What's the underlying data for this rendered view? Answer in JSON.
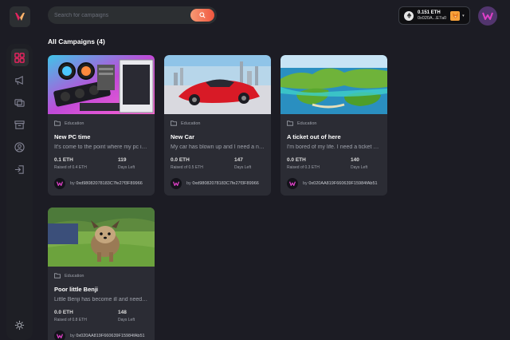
{
  "brand": {
    "logo_icon": "crowdfund-logo-icon",
    "accent": "#e0245e"
  },
  "sidebar": {
    "items": [
      {
        "name": "dashboard",
        "icon": "dashboard-icon",
        "active": true
      },
      {
        "name": "campaign",
        "icon": "megaphone-icon",
        "active": false
      },
      {
        "name": "payment",
        "icon": "payment-icon",
        "active": false
      },
      {
        "name": "withdraw",
        "icon": "withdraw-icon",
        "active": false
      },
      {
        "name": "profile",
        "icon": "profile-icon",
        "active": false
      },
      {
        "name": "logout",
        "icon": "logout-icon",
        "active": false
      }
    ],
    "theme_icon": "sun-icon"
  },
  "search": {
    "placeholder": "Search for campaigns",
    "value": ""
  },
  "wallet": {
    "balance": "0.151 ETH",
    "address": "0x020A...E7a0",
    "caret": "▾"
  },
  "section_title": "All Campaigns (4)",
  "campaigns": [
    {
      "category": "Education",
      "title": "New PC time",
      "description": "It's come to the point where my pc is too old to run anything",
      "raised": "0.1 ETH",
      "raised_label": "Raised of 0.4 ETH",
      "days": "119",
      "days_label": "Days Left",
      "by": "by",
      "owner": "0xd98082078183C7fe27f3F89966"
    },
    {
      "category": "Education",
      "title": "New Car",
      "description": "My car has blown up and I need a new one",
      "raised": "0.0 ETH",
      "raised_label": "Raised of 0.5 ETH",
      "days": "147",
      "days_label": "Days Left",
      "by": "by",
      "owner": "0xd98082078183C7fe27f3F89966"
    },
    {
      "category": "Education",
      "title": "A ticket out of here",
      "description": "I'm bored of my life. I need a ticket out of here",
      "raised": "0.0 ETH",
      "raised_label": "Raised of 0.3 ETH",
      "days": "140",
      "days_label": "Days Left",
      "by": "by",
      "owner": "0x020AA819F660639F15984fAb51"
    },
    {
      "category": "Education",
      "title": "Poor little Benji",
      "description": "Little Benji has become ill and needs an operation",
      "raised": "0.0 ETH",
      "raised_label": "Raised of 0.8 ETH",
      "days": "148",
      "days_label": "Days Left",
      "by": "by",
      "owner": "0x020AA819F660639F15984fAb51"
    }
  ]
}
